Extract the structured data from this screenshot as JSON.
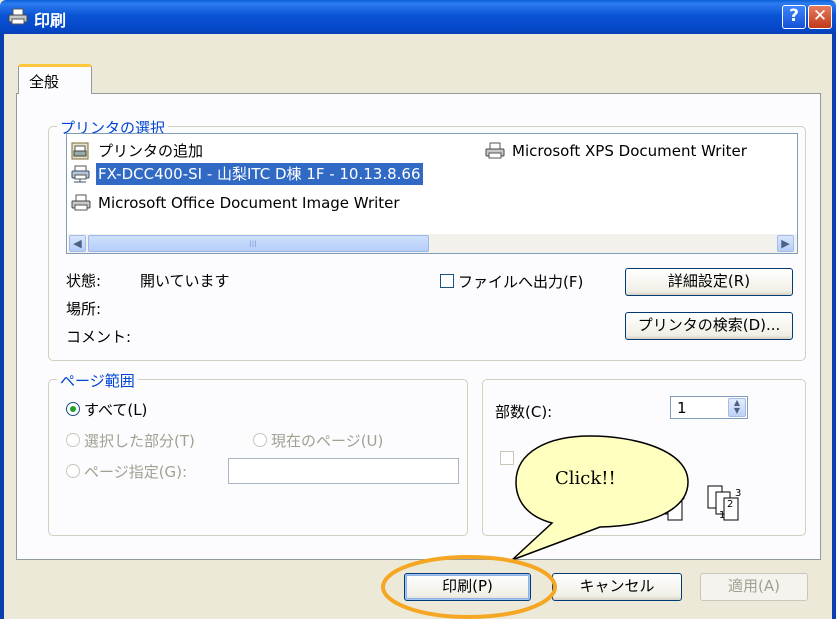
{
  "window": {
    "title": "印刷",
    "help_glyph": "?",
    "close_glyph": "✕"
  },
  "tabs": [
    {
      "label": "全般"
    }
  ],
  "printer_select": {
    "group_title": "プリンタの選択",
    "printers": [
      {
        "label": "プリンタの追加",
        "icon": "add-printer-icon",
        "selected": false
      },
      {
        "label": "FX-DCC400-SI - 山梨ITC D棟 1F - 10.13.8.66",
        "icon": "network-printer-icon",
        "selected": true
      },
      {
        "label": "Microsoft Office Document Image Writer",
        "icon": "printer-icon",
        "selected": false
      },
      {
        "label": "Microsoft XPS Document Writer",
        "icon": "printer-icon",
        "selected": false
      }
    ],
    "scroll_grip": "III",
    "status_label": "状態:",
    "status_value": "開いています",
    "location_label": "場所:",
    "comment_label": "コメント:",
    "print_to_file_label": "ファイルへ出力(F)",
    "preferences_button": "詳細設定(R)",
    "find_printer_button": "プリンタの検索(D)..."
  },
  "page_range": {
    "group_title": "ページ範囲",
    "all_label": "すべて(L)",
    "selection_label": "選択した部分(T)",
    "current_page_label": "現在のページ(U)",
    "pages_label": "ページ指定(G):",
    "pages_value": ""
  },
  "copies": {
    "label": "部数(C):",
    "value": "1"
  },
  "buttons": {
    "print": "印刷(P)",
    "cancel": "キャンセル",
    "apply": "適用(A)"
  },
  "callout": {
    "text": "Click!!"
  },
  "colors": {
    "titlebar": "#0a54d6",
    "group_title": "#0046d5",
    "selection": "#316ac5",
    "callout_fill": "#ffffc0",
    "highlight_ring": "#f5a623"
  }
}
